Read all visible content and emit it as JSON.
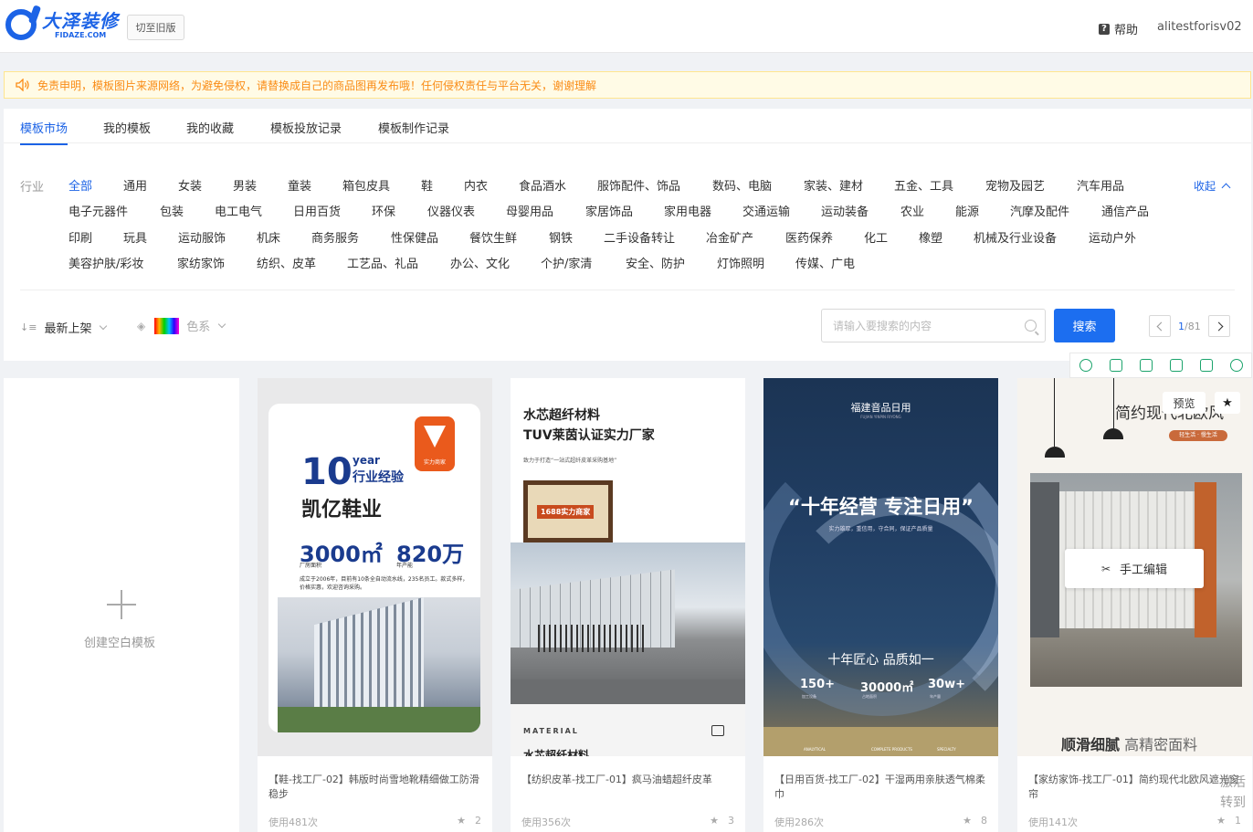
{
  "header": {
    "logo_cn": "大泽装修",
    "logo_en": "FIDAZE.COM",
    "old_version_label": "切至旧版",
    "help_label": "帮助",
    "user_name": "alitestforisv02"
  },
  "notice": {
    "text": "免责申明，模板图片来源网络，为避免侵权，请替换成自己的商品图再发布哦！任何侵权责任与平台无关，谢谢理解"
  },
  "tabs": [
    "模板市场",
    "我的模板",
    "我的收藏",
    "模板投放记录",
    "模板制作记录"
  ],
  "industry": {
    "label": "行业",
    "collapse_label": "收起",
    "rows": [
      [
        "全部",
        "通用",
        "女装",
        "男装",
        "童装",
        "箱包皮具",
        "鞋",
        "内衣",
        "食品酒水",
        "服饰配件、饰品",
        "数码、电脑",
        "家装、建材",
        "五金、工具",
        "宠物及园艺",
        "汽车用品"
      ],
      [
        "电子元器件",
        "包装",
        "电工电气",
        "日用百货",
        "环保",
        "仪器仪表",
        "母婴用品",
        "家居饰品",
        "家用电器",
        "交通运输",
        "运动装备",
        "农业",
        "能源",
        "汽摩及配件",
        "通信产品"
      ],
      [
        "印刷",
        "玩具",
        "运动服饰",
        "机床",
        "商务服务",
        "性保健品",
        "餐饮生鲜",
        "钢铁",
        "二手设备转让",
        "冶金矿产",
        "医药保养",
        "化工",
        "橡塑",
        "机械及行业设备",
        "运动户外"
      ],
      [
        "美容护肤/彩妆",
        "家纺家饰",
        "纺织、皮革",
        "工艺品、礼品",
        "办公、文化",
        "个护/家清",
        "安全、防护",
        "灯饰照明",
        "传媒、广电"
      ]
    ]
  },
  "filters": {
    "sort_label": "最新上架",
    "color_label": "色系",
    "search_placeholder": "请输入要搜索的内容",
    "search_button": "搜索",
    "page_current": "1",
    "page_total": "/81"
  },
  "blank_card": {
    "label": "创建空白模板"
  },
  "cards": [
    {
      "title": "【鞋-找工厂-02】韩版时尚雪地靴精细做工防滑稳步",
      "usage": "使用481次",
      "stars": "2",
      "thumb": {
        "badge": "实力商家",
        "num": "10",
        "year": "year",
        "exp": "行业经验",
        "name": "凯亿鞋业",
        "stat1": "3000㎡",
        "stat1_label": "厂房面积",
        "stat2": "820万",
        "stat2_label": "年产能",
        "desc": "成立于2006年，目前有10条全自动流水线，235名员工。款式多样，价格实惠，欢迎咨询采购。"
      }
    },
    {
      "title": "【纺织皮革-找工厂-01】疯马油蜡超纤皮革",
      "usage": "使用356次",
      "stars": "3",
      "thumb": {
        "title1": "水芯超纤材料",
        "title2": "TUV莱茵认证实力厂家",
        "sub": "致力于打造“一站式超纤皮革采购基地”",
        "cert": "1688实力商家",
        "material": "MATERIAL",
        "cut_text": "水芯超纤材料"
      }
    },
    {
      "title": "【日用百货-找工厂-02】干湿两用亲肤透气棉柔巾",
      "usage": "使用286次",
      "stars": "8",
      "thumb": {
        "brand": "福建音品日用",
        "brand_en": "FUJIAN YINPIN RIYONG",
        "quote": "“十年经营 专注日用”",
        "sub": "实力雄厚，重信用，守合同，保证产品质量",
        "mid": "十年匠心  品质如一",
        "n1": "150+",
        "n1_label": "加工设备",
        "n2": "30000㎡",
        "n2_label": "占地面积",
        "n3": "30w+",
        "n3_label": "年产量",
        "bar1": "ANALYTICAL",
        "bar2": "COMPLETE PRODUCTS",
        "bar3": "SPECIALTY"
      }
    },
    {
      "title": "【家纺家饰-找工厂-01】简约现代北欧风遮光窗帘",
      "usage": "使用141次",
      "stars": "1",
      "thumb": {
        "title": "简约现代北欧风",
        "sub": "轻生活 · 慢生活",
        "foot_bold": "顺滑细腻",
        "foot_light": "高精密面料",
        "preview": "预览",
        "edit": "手工编辑"
      }
    }
  ],
  "watermark": {
    "line1": "激活",
    "line2": "转到"
  },
  "colors": {
    "primary": "#1c63e6",
    "notice_bg": "#fffbe6",
    "notice_text": "#fa8c16",
    "tool_green": "#1aa36b"
  }
}
